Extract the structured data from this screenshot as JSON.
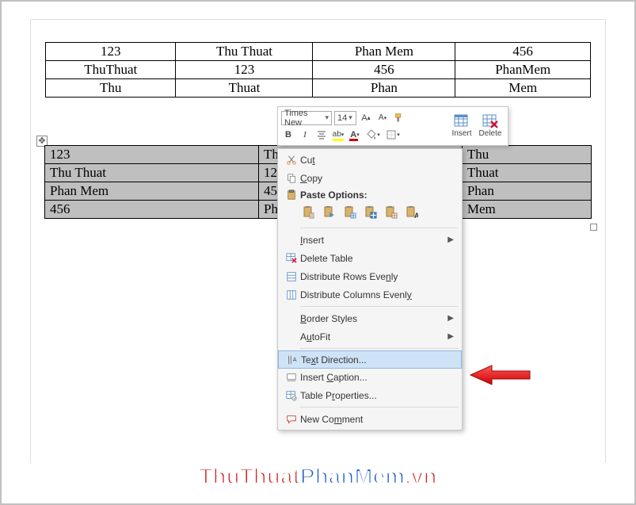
{
  "table1": {
    "rows": [
      [
        "123",
        "Thu Thuat",
        "Phan Mem",
        "456"
      ],
      [
        "ThuThuat",
        "123",
        "456",
        "PhanMem"
      ],
      [
        "Thu",
        "Thuat",
        "Phan",
        "Mem"
      ]
    ]
  },
  "table2": {
    "rows": [
      [
        "123",
        "ThuThuat",
        "Thu"
      ],
      [
        "Thu Thuat",
        "123",
        "Thuat"
      ],
      [
        "Phan Mem",
        "456",
        "Phan"
      ],
      [
        "456",
        "PhanMem",
        "Mem"
      ]
    ]
  },
  "mini_toolbar": {
    "font_name": "Times New",
    "font_size": "14",
    "insert_label": "Insert",
    "delete_label": "Delete"
  },
  "context_menu": {
    "cut": "Cut",
    "copy": "Copy",
    "paste_options": "Paste Options:",
    "insert": "Insert",
    "delete_table": "Delete Table",
    "distribute_rows": "Distribute Rows Evenly",
    "distribute_cols": "Distribute Columns Evenly",
    "border_styles": "Border Styles",
    "autofit": "AutoFit",
    "text_direction": "Text Direction...",
    "insert_caption": "Insert Caption...",
    "table_properties": "Table Properties...",
    "new_comment": "New Comment"
  },
  "watermark": {
    "part1": "ThuThuat",
    "part2": "PhanMem",
    "part3": ".vn"
  }
}
